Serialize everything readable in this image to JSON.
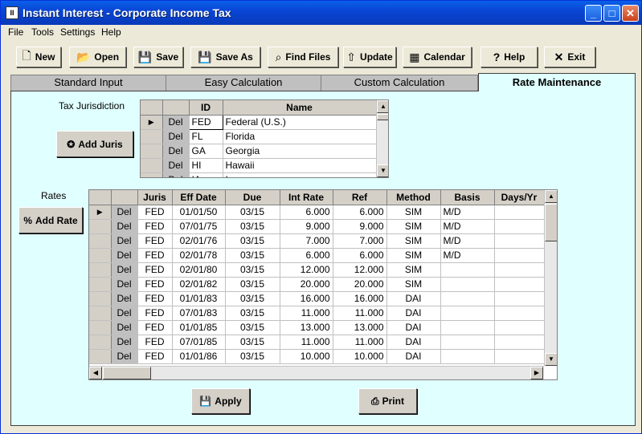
{
  "window": {
    "title": "Instant Interest - Corporate Income Tax",
    "app_icon": "II"
  },
  "menu": [
    "File",
    "Tools",
    "Settings",
    "Help"
  ],
  "toolbar": {
    "new": "New",
    "open": "Open",
    "save": "Save",
    "save_as": "Save As",
    "find_files": "Find Files",
    "update": "Update",
    "calendar": "Calendar",
    "help": "Help",
    "exit": "Exit"
  },
  "tabs": [
    "Standard Input",
    "Easy Calculation",
    "Custom Calculation",
    "Rate Maintenance"
  ],
  "juris": {
    "label": "Tax Jurisdiction",
    "add_button": "Add Juris",
    "headers": [
      "ID",
      "Name"
    ],
    "rows": [
      {
        "del": "Del",
        "id": "FED",
        "name": "Federal (U.S.)"
      },
      {
        "del": "Del",
        "id": "FL",
        "name": "Florida"
      },
      {
        "del": "Del",
        "id": "GA",
        "name": "Georgia"
      },
      {
        "del": "Del",
        "id": "HI",
        "name": "Hawaii"
      },
      {
        "del": "Del",
        "id": "IA",
        "name": "Iowa"
      }
    ]
  },
  "rates": {
    "label": "Rates",
    "add_button": "Add Rate",
    "headers": [
      "Juris",
      "Eff Date",
      "Due",
      "Int Rate",
      "Ref",
      "Method",
      "Basis",
      "Days/Yr"
    ],
    "rows": [
      [
        "Del",
        "FED",
        "01/01/50",
        "03/15",
        "6.000",
        "6.000",
        "SIM",
        "M/D",
        ""
      ],
      [
        "Del",
        "FED",
        "07/01/75",
        "03/15",
        "9.000",
        "9.000",
        "SIM",
        "M/D",
        ""
      ],
      [
        "Del",
        "FED",
        "02/01/76",
        "03/15",
        "7.000",
        "7.000",
        "SIM",
        "M/D",
        ""
      ],
      [
        "Del",
        "FED",
        "02/01/78",
        "03/15",
        "6.000",
        "6.000",
        "SIM",
        "M/D",
        ""
      ],
      [
        "Del",
        "FED",
        "02/01/80",
        "03/15",
        "12.000",
        "12.000",
        "SIM",
        "",
        ""
      ],
      [
        "Del",
        "FED",
        "02/01/82",
        "03/15",
        "20.000",
        "20.000",
        "SIM",
        "",
        ""
      ],
      [
        "Del",
        "FED",
        "01/01/83",
        "03/15",
        "16.000",
        "16.000",
        "DAI",
        "",
        ""
      ],
      [
        "Del",
        "FED",
        "07/01/83",
        "03/15",
        "11.000",
        "11.000",
        "DAI",
        "",
        ""
      ],
      [
        "Del",
        "FED",
        "01/01/85",
        "03/15",
        "13.000",
        "13.000",
        "DAI",
        "",
        ""
      ],
      [
        "Del",
        "FED",
        "07/01/85",
        "03/15",
        "11.000",
        "11.000",
        "DAI",
        "",
        ""
      ],
      [
        "Del",
        "FED",
        "01/01/86",
        "03/15",
        "10.000",
        "10.000",
        "DAI",
        "",
        ""
      ]
    ]
  },
  "actions": {
    "apply": "Apply",
    "print": "Print"
  }
}
